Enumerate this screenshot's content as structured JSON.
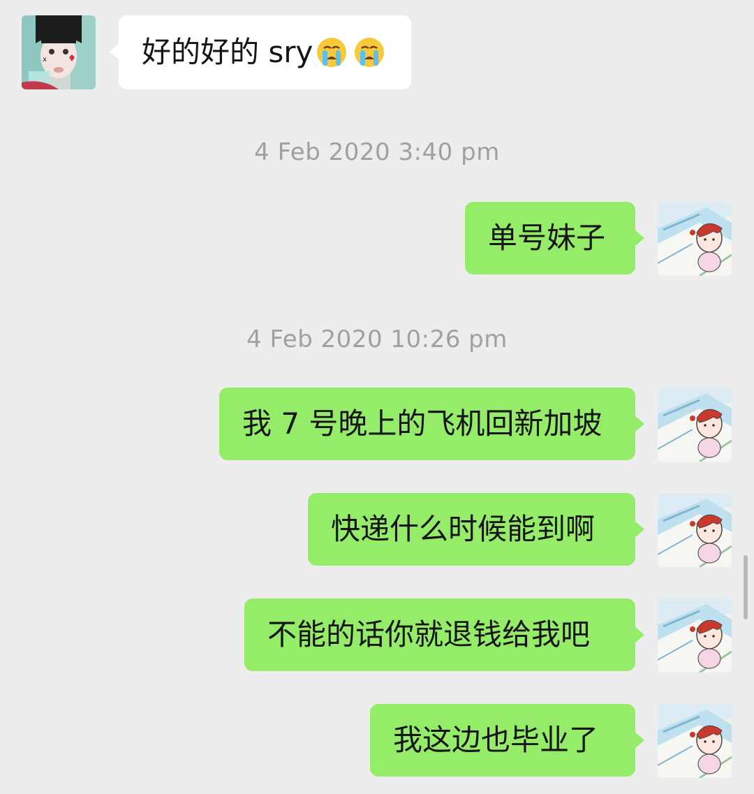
{
  "messages": [
    {
      "type": "incoming",
      "text": "好的好的 sry",
      "emoji": [
        "crying-face-icon",
        "crying-face-icon"
      ]
    },
    {
      "type": "timestamp",
      "text": "4 Feb 2020 3:40 pm"
    },
    {
      "type": "outgoing",
      "text": "单号妹子"
    },
    {
      "type": "timestamp",
      "text": "4 Feb 2020 10:26 pm"
    },
    {
      "type": "outgoing",
      "text": "我 7 号晚上的飞机回新加坡"
    },
    {
      "type": "outgoing",
      "text": "快递什么时候能到啊"
    },
    {
      "type": "outgoing",
      "text": "不能的话你就退钱给我吧"
    },
    {
      "type": "outgoing",
      "text": "我这边也毕业了"
    }
  ],
  "colors": {
    "background": "#ededed",
    "incoming_bubble": "#ffffff",
    "outgoing_bubble": "#95ec69",
    "timestamp_text": "#a0a0a0"
  }
}
